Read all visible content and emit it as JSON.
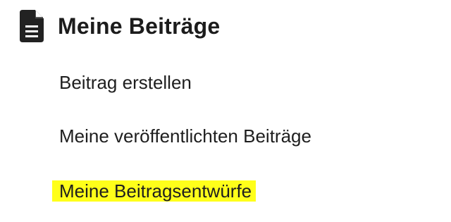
{
  "menu": {
    "title": "Meine Beiträge",
    "icon": "document-icon",
    "items": [
      {
        "label": "Beitrag erstellen",
        "highlighted": false
      },
      {
        "label": "Meine veröffentlichten Beiträge",
        "highlighted": false
      },
      {
        "label": "Meine Beitragsentwürfe",
        "highlighted": true
      }
    ]
  },
  "colors": {
    "highlight": "#ffff1a",
    "text": "#1e1e1e",
    "icon": "#222222"
  }
}
